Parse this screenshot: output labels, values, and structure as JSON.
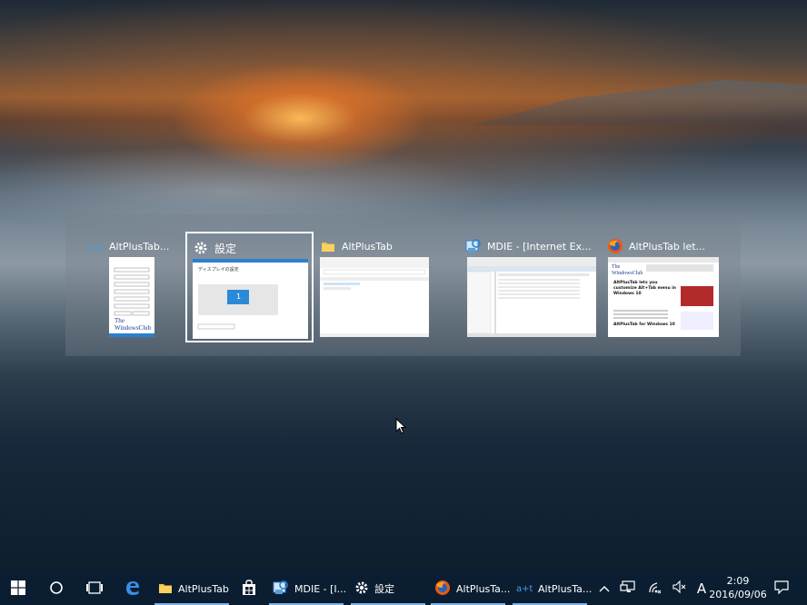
{
  "switcher": {
    "windows": [
      {
        "title": "AltPlusTab...",
        "icon": "altplustab-icon"
      },
      {
        "title": "設定",
        "icon": "gear-icon"
      },
      {
        "title": "AltPlusTab",
        "icon": "folder-icon"
      },
      {
        "title": "MDIE - [Internet Ex...",
        "icon": "mdie-icon"
      },
      {
        "title": "AltPlusTab let...",
        "icon": "firefox-icon"
      }
    ],
    "thumb1": {
      "brand_line1": "The",
      "brand_line2": "WindowsClub"
    },
    "thumb2": {
      "heading": "ディスプレイの設定",
      "number": "1"
    },
    "thumb5": {
      "brand_line1": "The",
      "brand_line2": "WindowsClub",
      "headline": "AltPlusTab lets you customize Alt+Tab menu in Windows 10",
      "subhead": "AltPlusTab for Windows 10"
    }
  },
  "taskbar": {
    "items": [
      {
        "label": "AltPlusTab"
      },
      {
        "label": "MDIE - [I..."
      },
      {
        "label": "設定"
      },
      {
        "label": "AltPlusTa..."
      },
      {
        "label": "AltPlusTa..."
      }
    ],
    "ime": "A",
    "time": "2:09",
    "date": "2016/09/06"
  },
  "colors": {
    "taskbar": "#0b1e31",
    "accent": "#1e7fd6",
    "underline": "#7fb3e6"
  }
}
